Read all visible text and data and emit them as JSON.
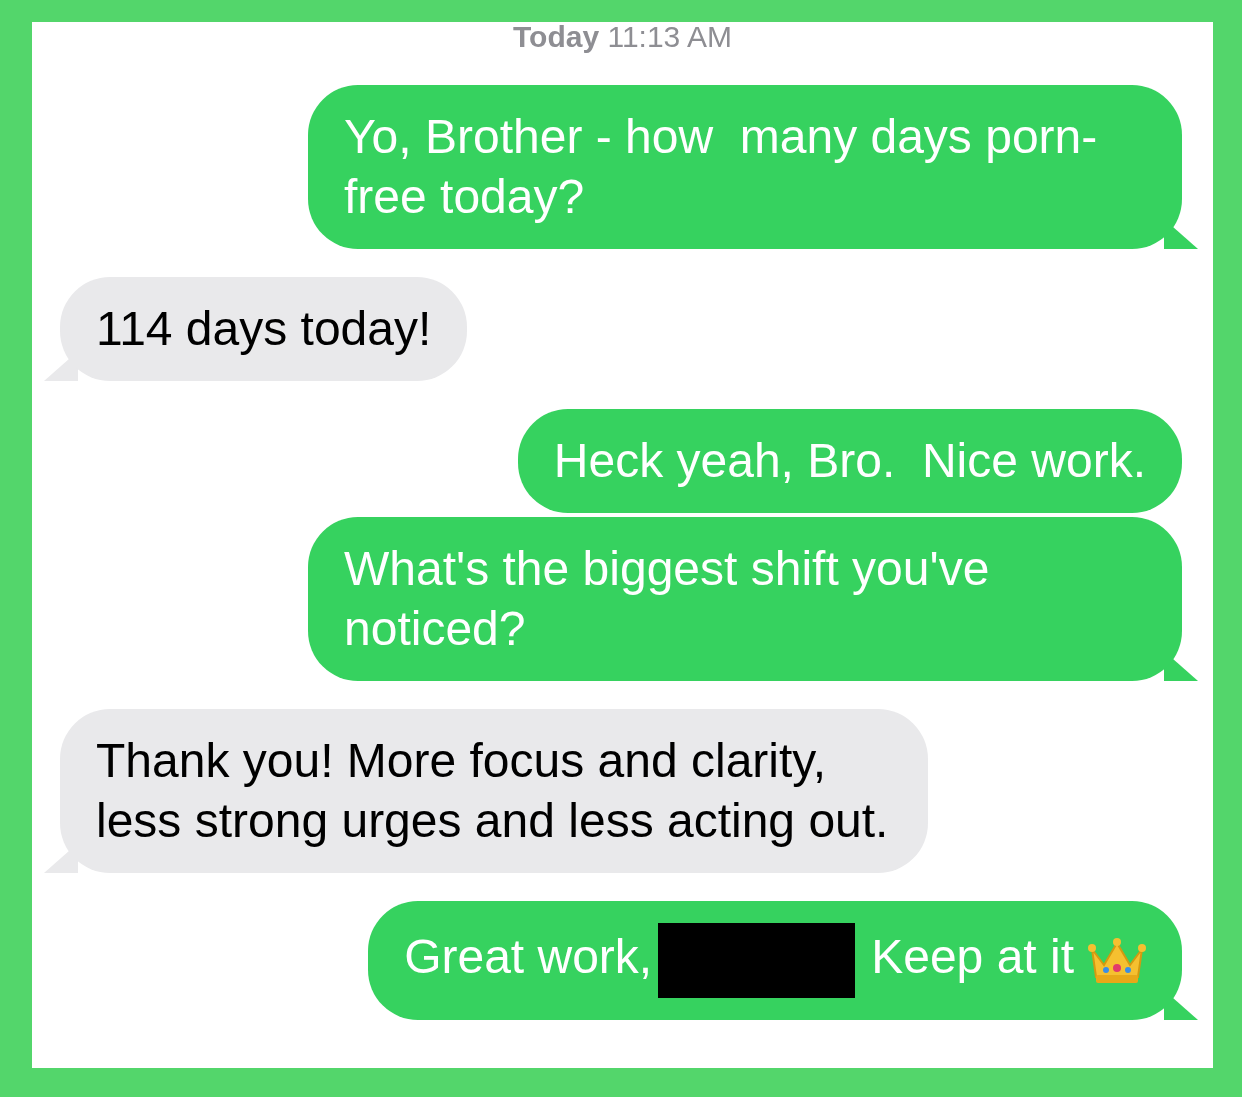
{
  "timestamp": {
    "day": "Today",
    "time": "11:13 AM"
  },
  "messages": [
    {
      "kind": "sent",
      "tail": true,
      "parts": [
        {
          "kind": "text",
          "text": "Yo, Brother - how  many days porn-free today?"
        }
      ]
    },
    {
      "kind": "received",
      "tail": true,
      "parts": [
        {
          "kind": "text",
          "text": "114 days today!"
        }
      ]
    },
    {
      "kind": "sent",
      "tail": false,
      "parts": [
        {
          "kind": "text",
          "text": "Heck yeah, Bro.  Nice work."
        }
      ]
    },
    {
      "kind": "sent",
      "tail": true,
      "parts": [
        {
          "kind": "text",
          "text": "What's the biggest shift you've noticed?"
        }
      ]
    },
    {
      "kind": "received",
      "tail": true,
      "parts": [
        {
          "kind": "text",
          "text": "Thank you! More focus and clarity, less strong urges and less acting out."
        }
      ]
    },
    {
      "kind": "sent",
      "tail": true,
      "parts": [
        {
          "kind": "text",
          "text": "Great work,"
        },
        {
          "kind": "redacted"
        },
        {
          "kind": "text",
          "text": "Keep at it"
        },
        {
          "kind": "crown"
        }
      ]
    }
  ]
}
